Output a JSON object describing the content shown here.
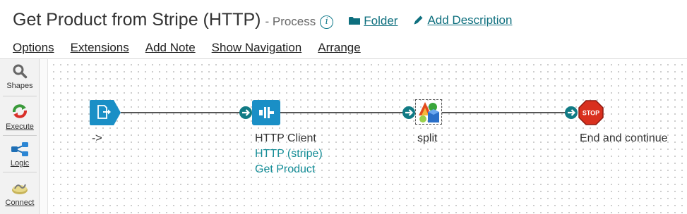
{
  "header": {
    "title": "Get Product from Stripe (HTTP)",
    "subtitle": "- Process",
    "folder_link": "Folder",
    "description_link": "Add Description"
  },
  "menu": [
    {
      "label": "Options"
    },
    {
      "label": "Extensions"
    },
    {
      "label": "Add Note"
    },
    {
      "label": "Show Navigation"
    },
    {
      "label": "Arrange"
    }
  ],
  "palette": {
    "shapes": "Shapes",
    "execute": "Execute",
    "logic": "Logic",
    "connect": "Connect"
  },
  "canvas": {
    "start": {
      "label": "->"
    },
    "http": {
      "label": "HTTP Client",
      "connection": "HTTP (stripe)",
      "operation": "Get Product"
    },
    "split": {
      "label": "split"
    },
    "stop": {
      "label": "End and continue",
      "icon_text": "STOP"
    }
  },
  "colors": {
    "accent": "#117a8b",
    "node_blue": "#1a8fc6",
    "stop_red": "#d9301e",
    "link_teal": "#138c96"
  }
}
